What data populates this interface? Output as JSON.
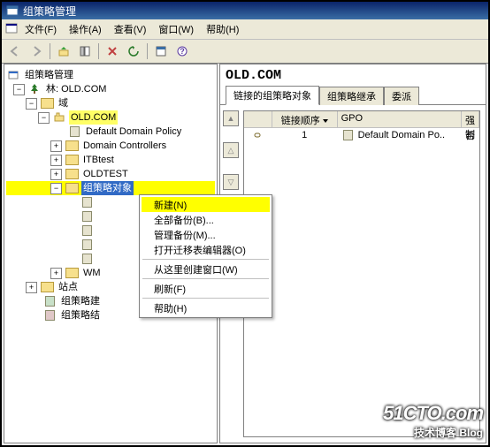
{
  "title": "组策略管理",
  "menubar": {
    "file": "文件(F)",
    "action": "操作(A)",
    "view": "查看(V)",
    "window": "窗口(W)",
    "help": "帮助(H)"
  },
  "tree": {
    "root": "组策略管理",
    "forest": "林: OLD.COM",
    "domains": "域",
    "domain": "OLD.COM",
    "ddp": "Default Domain Policy",
    "dc": "Domain Controllers",
    "itb": "ITBtest",
    "oldtest": "OLDTEST",
    "gpo": "组策略对象",
    "wmi_prefix": "WM",
    "sites": "站点",
    "gpmodeling": "组策略建",
    "gpresults": "组策略结"
  },
  "context_menu": {
    "new": "新建(N)",
    "backup_all": "全部备份(B)...",
    "manage_backups": "管理备份(M)...",
    "open_migration": "打开迁移表编辑器(O)",
    "new_window": "从这里创建窗口(W)",
    "refresh": "刷新(F)",
    "help": "帮助(H)"
  },
  "right": {
    "heading": "OLD.COM",
    "tabs": {
      "linked": "链接的组策略对象",
      "inherit": "组策略继承",
      "deleg": "委派"
    },
    "columns": {
      "order": "链接顺序",
      "gpo": "GPO",
      "enforced": "强制"
    },
    "row": {
      "order": "1",
      "gpo": "Default Domain Po..",
      "enforced": "否"
    }
  },
  "watermark": {
    "big": "51CTO.com",
    "small": "技术博客  Blog"
  }
}
